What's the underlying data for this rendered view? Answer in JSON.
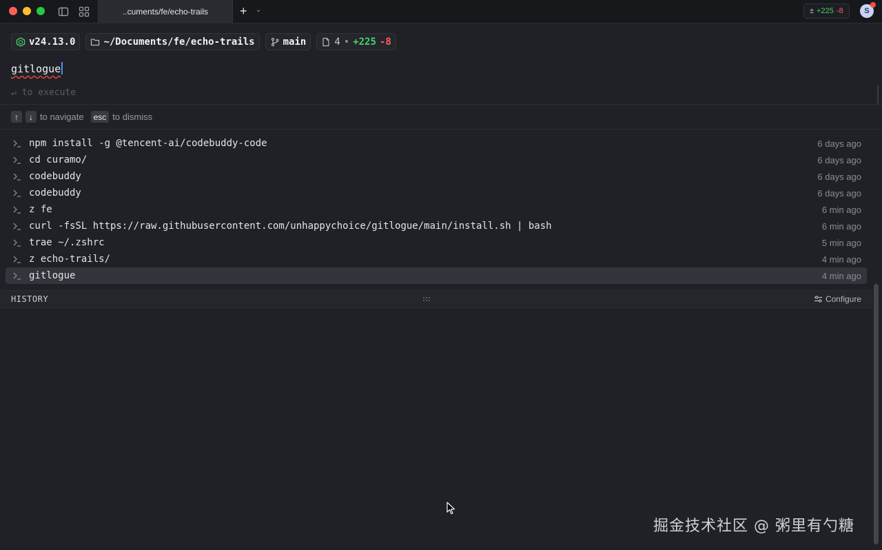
{
  "titlebar": {
    "tab_title": "..cuments/fe/echo-trails",
    "diff": {
      "symbol": "±",
      "added": "+225",
      "removed": "-8"
    },
    "avatar_initial": "S"
  },
  "context": {
    "node_version": "v24.13.0",
    "directory": "~/Documents/fe/echo-trails",
    "branch": "main",
    "files_changed": "4",
    "added": "+225",
    "removed": "-8"
  },
  "prompt": {
    "input_value": "gitlogue",
    "execute_hint": "to execute"
  },
  "nav_hint": {
    "up_key": "↑",
    "down_key": "↓",
    "navigate_text": "to navigate",
    "esc_key": "esc",
    "dismiss_text": "to dismiss"
  },
  "history": [
    {
      "command": "npm install -g @tencent-ai/codebuddy-code",
      "time": "6 days ago"
    },
    {
      "command": "cd curamo/",
      "time": "6 days ago"
    },
    {
      "command": "codebuddy",
      "time": "6 days ago"
    },
    {
      "command": "codebuddy",
      "time": "6 days ago"
    },
    {
      "command": "z fe",
      "time": "6 min ago"
    },
    {
      "command": "curl -fsSL https://raw.githubusercontent.com/unhappychoice/gitlogue/main/install.sh | bash",
      "time": "6 min ago"
    },
    {
      "command": "trae ~/.zshrc",
      "time": "5 min ago"
    },
    {
      "command": "z echo-trails/",
      "time": "4 min ago"
    },
    {
      "command": "gitlogue",
      "time": "4 min ago"
    }
  ],
  "panel": {
    "title": "HISTORY",
    "configure_label": "Configure"
  },
  "watermark": "掘金技术社区 @ 粥里有勺糖",
  "colors": {
    "background": "#202126",
    "added": "#46d36a",
    "removed": "#ff5c5c",
    "cursor": "#4e8df5",
    "selected_row": "#34353c"
  }
}
